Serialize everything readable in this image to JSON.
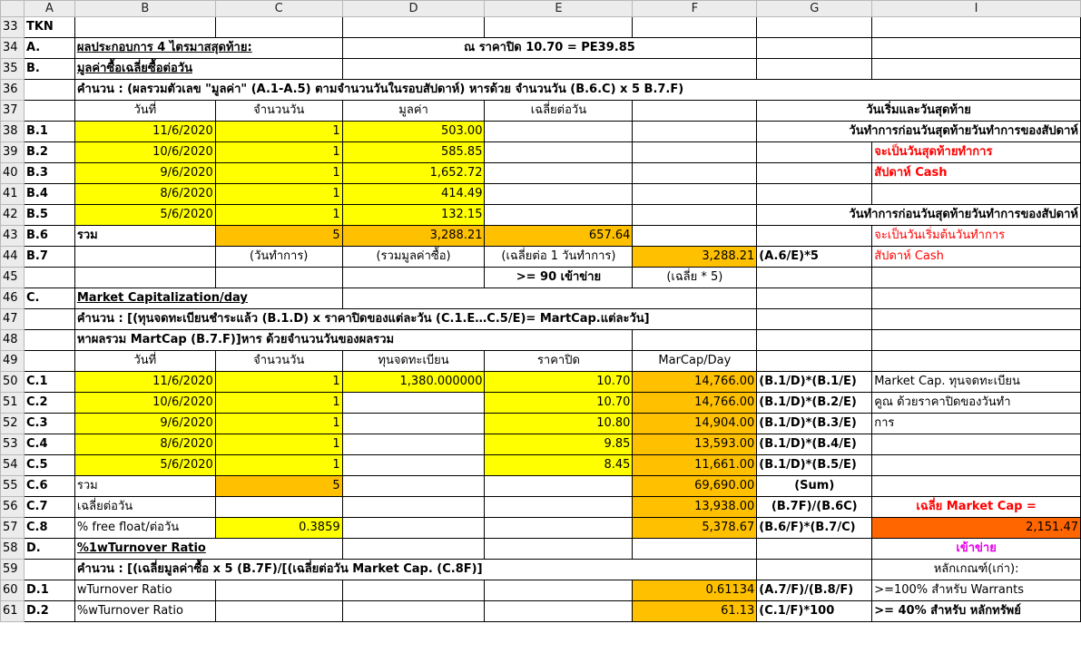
{
  "columns": [
    "A",
    "B",
    "C",
    "D",
    "E",
    "F",
    "G",
    "I"
  ],
  "rows": {
    "r33": {
      "num": "33",
      "a": "TKN"
    },
    "r34": {
      "num": "34",
      "a": "A.",
      "b": "ผลประกอบการ 4 ไตรมาสสุดท้าย:",
      "e": "ณ ราคาปิด 10.70 = PE39.85"
    },
    "r35": {
      "num": "35",
      "a": "B.",
      "b": "มูลค่าซื้อเฉลี่ยซื้อต่อวัน"
    },
    "r36": {
      "num": "36",
      "b": "คำนวน : (ผลรวมตัวเลข \"มูลค่า\" (A.1-A.5) ตามจำนวนวันในรอบสัปดาห์) หารด้วย  จำนวนวัน (B.6.C) x 5 B.7.F)"
    },
    "r37": {
      "num": "37",
      "b": "วันที่",
      "c": "จำนวนวัน",
      "d": "มูลค่า",
      "e": "เฉลี่ยต่อวัน",
      "gi": "วันเริ่มและวันสุดท้าย"
    },
    "r38": {
      "num": "38",
      "a": "B.1",
      "b": "11/6/2020",
      "c": "1",
      "d": "503.00",
      "gi": "วันทำการก่อนวันสุดท้ายวันทำการของสัปดาห์"
    },
    "r39": {
      "num": "39",
      "a": "B.2",
      "b": "10/6/2020",
      "c": "1",
      "d": "585.85",
      "i": "จะเป็นวันสุดท้ายทำการ"
    },
    "r40": {
      "num": "40",
      "a": "B.3",
      "b": "9/6/2020",
      "c": "1",
      "d": "1,652.72",
      "i": "สัปดาห์ Cash"
    },
    "r41": {
      "num": "41",
      "a": "B.4",
      "b": "8/6/2020",
      "c": "1",
      "d": "414.49"
    },
    "r42": {
      "num": "42",
      "a": "B.5",
      "b": "5/6/2020",
      "c": "1",
      "d": "132.15",
      "gi": "วันทำการก่อนวันสุดท้ายวันทำการของสัปดาห์"
    },
    "r43": {
      "num": "43",
      "a": "B.6",
      "b": "รวม",
      "c": "5",
      "d": "3,288.21",
      "e": "657.64",
      "i": "จะเป็นวันเริ่มต้นวันทำการ"
    },
    "r44": {
      "num": "44",
      "a": "B.7",
      "c": "(วันทำการ)",
      "d": "(รวมมูลค่าซื้อ)",
      "e": "(เฉลี่ยต่อ 1 วันทำการ)",
      "f": "3,288.21",
      "g": "(A.6/E)*5",
      "i": "สัปดาห์ Cash"
    },
    "r45": {
      "num": "45",
      "e": ">= 90 เข้าข่าย",
      "f": "(เฉลี่ย * 5)"
    },
    "r46": {
      "num": "46",
      "a": "C.",
      "b": "Market Capitalization/day"
    },
    "r47": {
      "num": "47",
      "b": "คำนวน :  [(ทุนจดทะเบียนชำระแล้ว (B.1.D) x ราคาปิดของแต่ละวัน (C.1.E…C.5/E)= MartCap.แต่ละวัน]"
    },
    "r48": {
      "num": "48",
      "b": "หาผลรวม MartCap (B.7.F)]หาร ด้วยจำนวนวันของผลรวม"
    },
    "r49": {
      "num": "49",
      "b": "วันที่",
      "c": "จำนวนวัน",
      "d": "ทุนจดทะเบียน",
      "e": "ราคาปิด",
      "f": "MarCap/Day"
    },
    "r50": {
      "num": "50",
      "a": "C.1",
      "b": "11/6/2020",
      "c": "1",
      "d": "1,380.000000",
      "e": "10.70",
      "f": "14,766.00",
      "g": "(B.1/D)*(B.1/E)",
      "i": "Market Cap. ทุนจดทะเบียน"
    },
    "r51": {
      "num": "51",
      "a": "C.2",
      "b": "10/6/2020",
      "c": "1",
      "e": "10.70",
      "f": "14,766.00",
      "g": "(B.1/D)*(B.2/E)",
      "i": "คูณ ด้วยราคาปิดของวันทำ"
    },
    "r52": {
      "num": "52",
      "a": "C.3",
      "b": "9/6/2020",
      "c": "1",
      "e": "10.80",
      "f": "14,904.00",
      "g": "(B.1/D)*(B.3/E)",
      "i": "การ"
    },
    "r53": {
      "num": "53",
      "a": "C.4",
      "b": "8/6/2020",
      "c": "1",
      "e": "9.85",
      "f": "13,593.00",
      "g": "(B.1/D)*(B.4/E)"
    },
    "r54": {
      "num": "54",
      "a": "C.5",
      "b": "5/6/2020",
      "c": "1",
      "e": "8.45",
      "f": "11,661.00",
      "g": "(B.1/D)*(B.5/E)"
    },
    "r55": {
      "num": "55",
      "a": "C.6",
      "b": "รวม",
      "c": "5",
      "f": "69,690.00",
      "g": "(Sum)"
    },
    "r56": {
      "num": "56",
      "a": "C.7",
      "b": "เฉลี่ยต่อวัน",
      "f": "13,938.00",
      "g": "(B.7F)/(B.6C)",
      "i": "เฉลี่ย Market Cap ="
    },
    "r57": {
      "num": "57",
      "a": "C.8",
      "b": "% free float/ต่อวัน",
      "c": "0.3859",
      "f": "5,378.67",
      "g": "(B.6/F)*(B.7/C)",
      "i": "2,151.47"
    },
    "r58": {
      "num": "58",
      "a": "D.",
      "b": "%1wTurnover Ratio",
      "i": "เข้าข่าย"
    },
    "r59": {
      "num": "59",
      "b": "คำนวน :  [(เฉลี่ยมูลค่าซื้อ x 5  (B.7F)/[(เฉลี่ยต่อวัน Market Cap. (C.8F)]",
      "i": "หลักเกณฑ์(เก่า):"
    },
    "r60": {
      "num": "60",
      "a": "D.1",
      "b": "wTurnover Ratio",
      "f": "0.61134",
      "g": "(A.7/F)/(B.8/F)",
      "i": ">=100% สำหรับ Warrants"
    },
    "r61": {
      "num": "61",
      "a": "D.2",
      "b": " %wTurnover Ratio",
      "f": "61.13",
      "g": "(C.1/F)*100",
      "i": ">= 40% สำหรับ หลักทรัพย์"
    }
  }
}
